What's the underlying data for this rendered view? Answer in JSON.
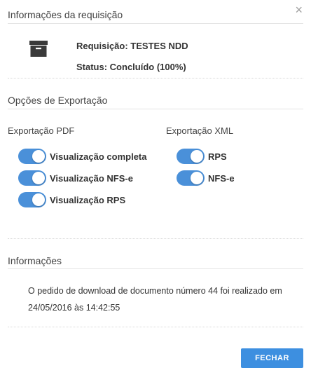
{
  "dialog": {
    "close_symbol": "×"
  },
  "request_info": {
    "title": "Informações da requisição",
    "requisicao": "Requisição: TESTES NDD",
    "status": "Status: Concluído (100%)",
    "icon": "archive-box-icon"
  },
  "export_options": {
    "title": "Opções de Exportação",
    "pdf": {
      "title": "Exportação PDF",
      "items": [
        {
          "label": "Visualização completa",
          "on": true
        },
        {
          "label": "Visualização NFS-e",
          "on": true
        },
        {
          "label": "Visualização RPS",
          "on": true
        }
      ]
    },
    "xml": {
      "title": "Exportação XML",
      "items": [
        {
          "label": "RPS",
          "on": true
        },
        {
          "label": "NFS-e",
          "on": true
        }
      ]
    }
  },
  "informacoes": {
    "title": "Informações",
    "message": "O pedido de download de documento número 44 foi realizado em 24/05/2016 às 14:42:55"
  },
  "footer": {
    "close_label": "FECHAR"
  },
  "colors": {
    "accent": "#3d8fe0",
    "toggle_on": "#4a90d9"
  }
}
